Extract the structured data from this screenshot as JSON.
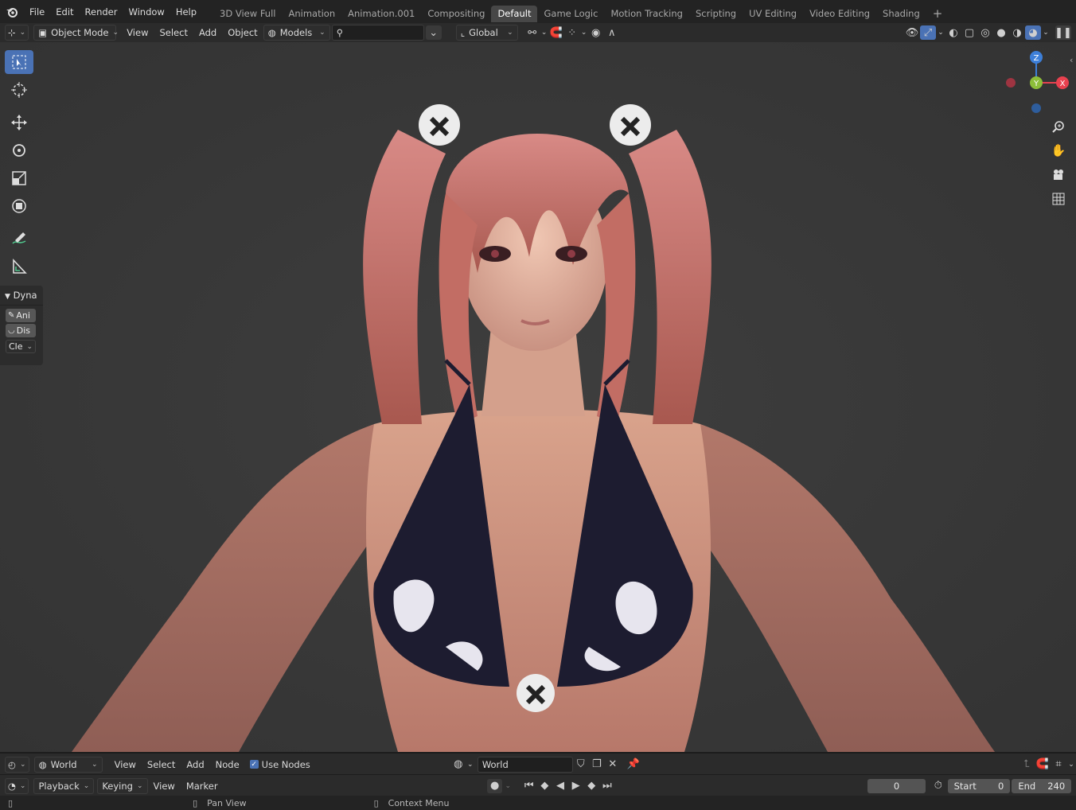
{
  "topbar": {
    "menus": [
      "File",
      "Edit",
      "Render",
      "Window",
      "Help"
    ],
    "workspaces": [
      "3D View Full",
      "Animation",
      "Animation.001",
      "Compositing",
      "Default",
      "Game Logic",
      "Motion Tracking",
      "Scripting",
      "UV Editing",
      "Video Editing",
      "Shading"
    ],
    "active_workspace": "Default",
    "add_tab": "+"
  },
  "viewport_header": {
    "mode": "Object Mode",
    "menus": [
      "View",
      "Select",
      "Add",
      "Object"
    ],
    "collection": "Models",
    "search_value": "",
    "orientation": "Global"
  },
  "dyna_panel": {
    "title": "Dyna",
    "rows": [
      "Ani",
      "Dis",
      "Cle"
    ]
  },
  "gizmo": {
    "z": "Z",
    "y": "Y",
    "x": "X",
    "colors": {
      "x": "#e8414f",
      "y": "#8dbe3a",
      "z": "#3d7fd8"
    }
  },
  "node_editor_header": {
    "menus": [
      "View",
      "Select",
      "Add",
      "Node"
    ],
    "world_type": "World",
    "use_nodes_label": "Use Nodes",
    "use_nodes_checked": true,
    "world_name": "World"
  },
  "timeline": {
    "menus": [
      "Playback",
      "Keying",
      "View",
      "Marker"
    ],
    "current_frame": "0",
    "start_label": "Start",
    "start_value": "0",
    "end_label": "End",
    "end_value": "240"
  },
  "statusbar": {
    "pan_view": "Pan View",
    "context_menu": "Context Menu"
  }
}
